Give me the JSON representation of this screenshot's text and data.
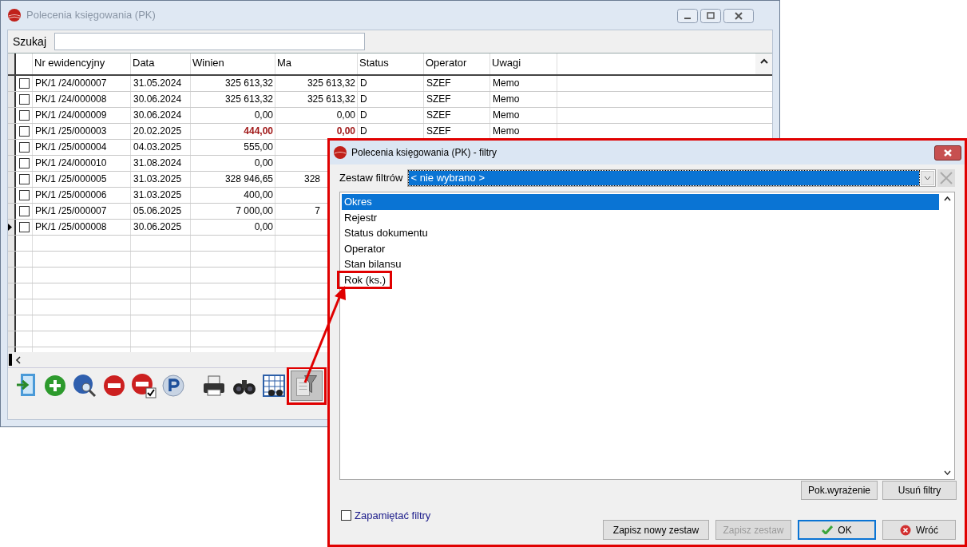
{
  "main_window": {
    "title": "Polecenia księgowania (PK)",
    "search": {
      "label": "Szukaj"
    },
    "columns": [
      "Nr ewidencyjny",
      "Data",
      "Winien",
      "Ma",
      "Status",
      "Operator",
      "Uwagi"
    ],
    "rows": [
      {
        "nr": "PK/1  /24/000007",
        "data": "31.05.2024",
        "winien": "325 613,32",
        "ma": "325 613,32",
        "status": "D",
        "operator": "SZEF",
        "uwagi": "Memo",
        "checked": false,
        "current": false,
        "highlighted": false
      },
      {
        "nr": "PK/1  /24/000008",
        "data": "30.06.2024",
        "winien": "325 613,32",
        "ma": "325 613,32",
        "status": "D",
        "operator": "SZEF",
        "uwagi": "Memo",
        "checked": false,
        "current": false,
        "highlighted": false
      },
      {
        "nr": "PK/1  /24/000009",
        "data": "30.06.2024",
        "winien": "0,00",
        "ma": "0,00",
        "status": "D",
        "operator": "SZEF",
        "uwagi": "Memo",
        "checked": false,
        "current": false,
        "highlighted": false
      },
      {
        "nr": "PK/1  /25/000003",
        "data": "20.02.2025",
        "winien": "444,00",
        "ma": "0,00",
        "status": "D",
        "operator": "SZEF",
        "uwagi": "Memo",
        "checked": false,
        "current": false,
        "highlighted": true
      },
      {
        "nr": "PK/1  /25/000004",
        "data": "04.03.2025",
        "winien": "555,00",
        "checked": false,
        "current": false,
        "highlighted": false
      },
      {
        "nr": "PK/1  /24/000010",
        "data": "31.08.2024",
        "winien": "0,00",
        "checked": false,
        "current": false,
        "highlighted": false
      },
      {
        "nr": "PK/1  /25/000005",
        "data": "31.03.2025",
        "winien": "328 946,65",
        "ma": "328",
        "checked": false,
        "current": false,
        "highlighted": false
      },
      {
        "nr": "PK/1  /25/000006",
        "data": "31.03.2025",
        "winien": "400,00",
        "checked": false,
        "current": false,
        "highlighted": false
      },
      {
        "nr": "PK/1  /25/000007",
        "data": "05.06.2025",
        "winien": "7 000,00",
        "ma": "7",
        "checked": false,
        "current": false,
        "highlighted": false
      },
      {
        "nr": "PK/1  /25/000008",
        "data": "30.06.2025",
        "winien": "0,00",
        "checked": false,
        "current": true,
        "highlighted": false
      }
    ]
  },
  "filter_dialog": {
    "title": "Polecenia księgowania (PK) - filtry",
    "filter_set": {
      "label": "Zestaw filtrów",
      "value": "< nie wybrano >"
    },
    "filters": [
      {
        "label": "Okres",
        "selected": true
      },
      {
        "label": "Rejestr",
        "selected": false
      },
      {
        "label": "Status dokumentu",
        "selected": false
      },
      {
        "label": "Operator",
        "selected": false
      },
      {
        "label": "Stan bilansu",
        "selected": false
      },
      {
        "label": "Rok (ks.)",
        "selected": false
      }
    ],
    "list_buttons": [
      {
        "label": "Pok.wyrażenie",
        "disabled": false
      },
      {
        "label": "Usuń filtry",
        "disabled": false
      }
    ],
    "remember": {
      "label": "Zapamiętać filtry",
      "checked": false
    },
    "buttons": [
      {
        "label": "Zapisz nowy zestaw",
        "kind": "plain",
        "disabled": false,
        "focused": false
      },
      {
        "label": "Zapisz zestaw",
        "kind": "plain",
        "disabled": true,
        "focused": false
      },
      {
        "label": "OK",
        "kind": "ok",
        "disabled": false,
        "focused": true
      },
      {
        "label": "Wróć",
        "kind": "cancel",
        "disabled": false,
        "focused": false
      }
    ]
  }
}
